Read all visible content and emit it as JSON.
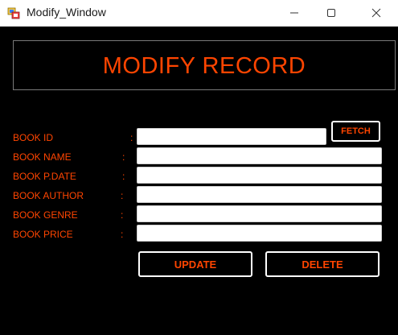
{
  "window": {
    "title": "Modify_Window",
    "controls": [
      "minimize-icon",
      "maximize-icon",
      "close-icon"
    ]
  },
  "header": {
    "title": "MODIFY RECORD"
  },
  "form": {
    "separator": ":",
    "fields": [
      {
        "label": "BOOK ID",
        "value": "",
        "placeholder": ""
      },
      {
        "label": "BOOK NAME",
        "value": "",
        "placeholder": ""
      },
      {
        "label": "BOOK P.DATE",
        "value": "",
        "placeholder": ""
      },
      {
        "label": "BOOK AUTHOR",
        "value": "",
        "placeholder": ""
      },
      {
        "label": "BOOK GENRE",
        "value": "",
        "placeholder": ""
      },
      {
        "label": "BOOK PRICE",
        "value": "",
        "placeholder": ""
      }
    ]
  },
  "buttons": {
    "fetch": "FETCH",
    "update": "UPDATE",
    "delete": "DELETE"
  },
  "colors": {
    "accent": "#ff4500",
    "background": "#000000",
    "button_border": "#ffffff",
    "titlebar": "#ffffff"
  }
}
